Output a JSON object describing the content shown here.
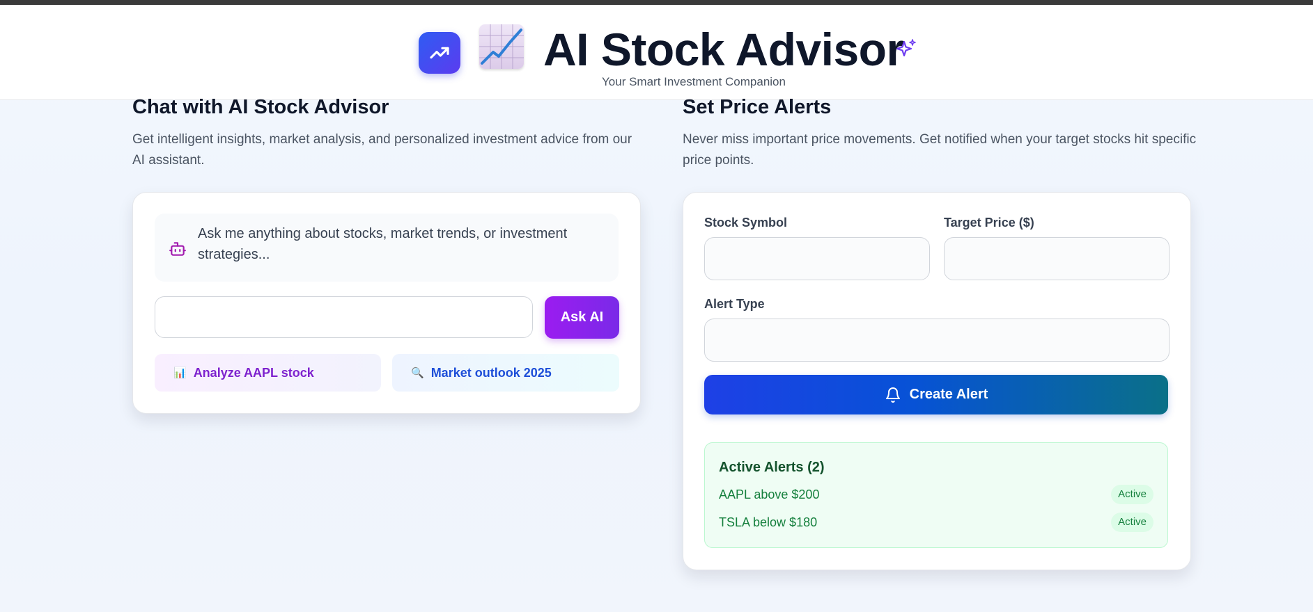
{
  "header": {
    "logo_icon": "trending-up-icon",
    "chart_icon": "chart-increasing-emoji",
    "title": "AI Stock Advisor",
    "sparkle_icon": "sparkles-icon",
    "subtitle": "Your Smart Investment Companion"
  },
  "chat": {
    "title": "Chat with AI Stock Advisor",
    "description": "Get intelligent insights, market analysis, and personalized investment advice from our AI assistant.",
    "bot_icon": "robot-icon",
    "bot_message": "Ask me anything about stocks, market trends, or investment strategies...",
    "input_value": "",
    "ask_button": "Ask AI",
    "suggestions": [
      {
        "icon": "📊",
        "label": "Analyze AAPL stock"
      },
      {
        "icon": "🔍",
        "label": "Market outlook 2025"
      }
    ]
  },
  "alerts": {
    "title": "Set Price Alerts",
    "description": "Never miss important price movements. Get notified when your target stocks hit specific price points.",
    "symbol_label": "Stock Symbol",
    "symbol_value": "",
    "price_label": "Target Price ($)",
    "price_value": "",
    "type_label": "Alert Type",
    "type_value": "",
    "create_button": "Create Alert",
    "active_title": "Active Alerts (2)",
    "items": [
      {
        "text": "AAPL above $200",
        "status": "Active"
      },
      {
        "text": "TSLA below $180",
        "status": "Active"
      }
    ]
  },
  "colors": {
    "primary_purple": "#9b1cf0",
    "primary_blue": "#1e40e6",
    "success_green": "#15803d"
  }
}
